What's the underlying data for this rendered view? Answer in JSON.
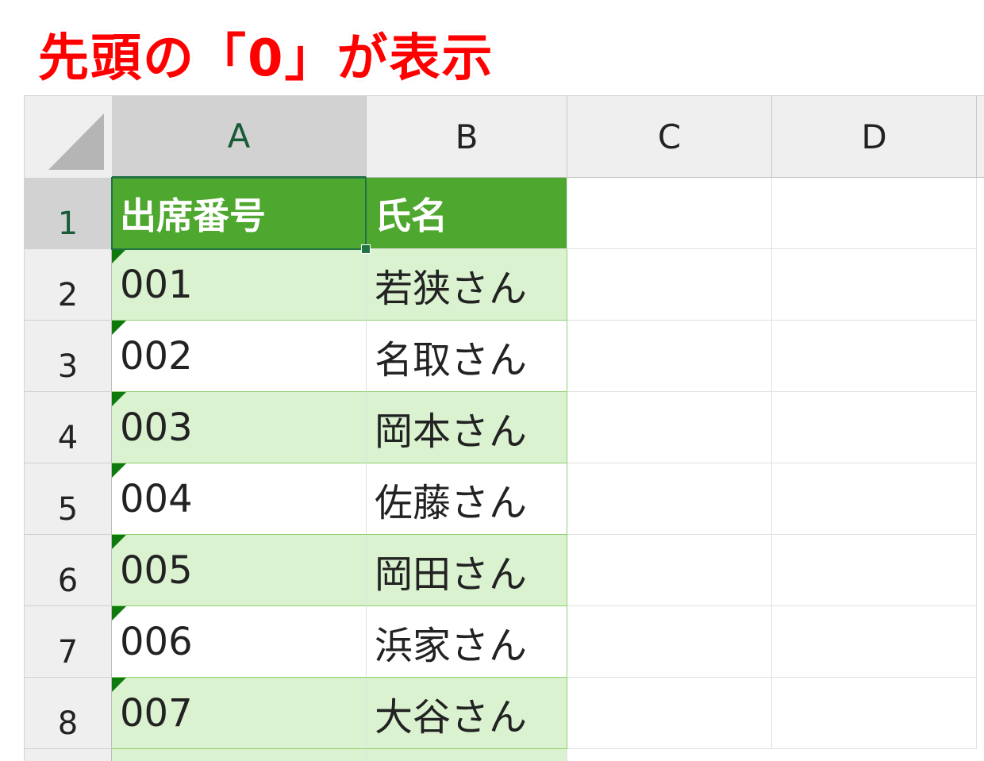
{
  "title": "先頭の「0」が表示",
  "columns": [
    "A",
    "B",
    "C",
    "D"
  ],
  "rows": [
    {
      "num": "1",
      "a": "出席番号",
      "b": "氏名"
    },
    {
      "num": "2",
      "a": "001",
      "b": "若狭さん"
    },
    {
      "num": "3",
      "a": "002",
      "b": "名取さん"
    },
    {
      "num": "4",
      "a": "003",
      "b": "岡本さん"
    },
    {
      "num": "5",
      "a": "004",
      "b": "佐藤さん"
    },
    {
      "num": "6",
      "a": "005",
      "b": "岡田さん"
    },
    {
      "num": "7",
      "a": "006",
      "b": "浜家さん"
    },
    {
      "num": "8",
      "a": "007",
      "b": "大谷さん"
    }
  ],
  "colors": {
    "title": "#ff0000",
    "table_header": "#4ea72e",
    "table_band": "#daf2d0",
    "error_indicator": "#0e7a0d",
    "selection": "#217346"
  }
}
